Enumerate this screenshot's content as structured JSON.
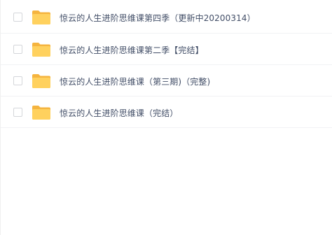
{
  "file_list": {
    "items": [
      {
        "name": "惊云的人生进阶思维课第四季（更新中20200314）",
        "icon": "folder-icon",
        "checked": false
      },
      {
        "name": "惊云的人生进阶思维课第二季【完结】",
        "icon": "folder-icon",
        "checked": false
      },
      {
        "name": "惊云的人生进阶思维课（第三期)（完整)",
        "icon": "folder-icon",
        "checked": false
      },
      {
        "name": "惊云的人生进阶思维课（完结）",
        "icon": "folder-icon",
        "checked": false
      }
    ]
  },
  "colors": {
    "folder_body": "#ffd15e",
    "folder_tab": "#f5b43f",
    "text": "#424e67",
    "divider": "#f1f2f4",
    "checkbox_border": "#d4d6da"
  }
}
